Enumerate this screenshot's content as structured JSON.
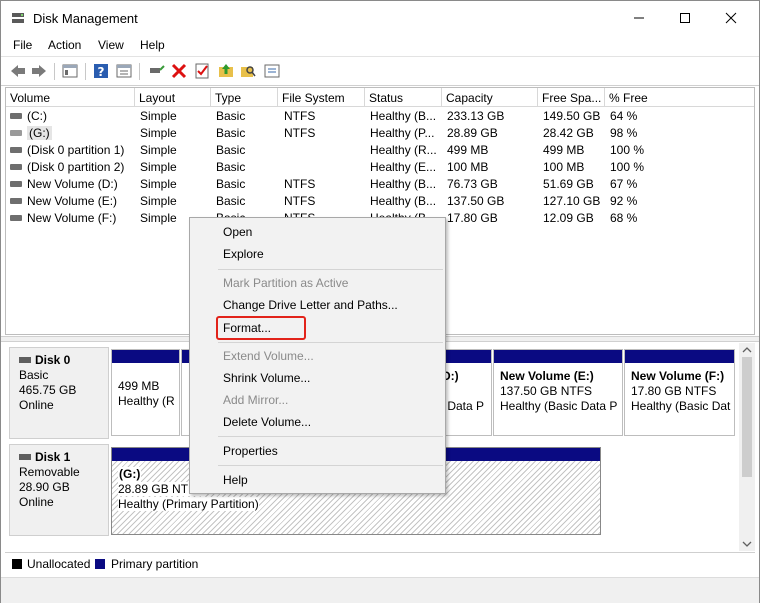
{
  "window": {
    "title": "Disk Management"
  },
  "menu": [
    "File",
    "Action",
    "View",
    "Help"
  ],
  "columns": [
    "Volume",
    "Layout",
    "Type",
    "File System",
    "Status",
    "Capacity",
    "Free Spa...",
    "% Free"
  ],
  "volumes": [
    {
      "volume": "(C:)",
      "layout": "Simple",
      "type": "Basic",
      "fs": "NTFS",
      "status": "Healthy (B...",
      "capacity": "233.13 GB",
      "free": "149.50 GB",
      "pct": "64 %"
    },
    {
      "volume": "(G:)",
      "layout": "Simple",
      "type": "Basic",
      "fs": "NTFS",
      "status": "Healthy (P...",
      "capacity": "28.89 GB",
      "free": "28.42 GB",
      "pct": "98 %"
    },
    {
      "volume": "(Disk 0 partition 1)",
      "layout": "Simple",
      "type": "Basic",
      "fs": "",
      "status": "Healthy (R...",
      "capacity": "499 MB",
      "free": "499 MB",
      "pct": "100 %"
    },
    {
      "volume": "(Disk 0 partition 2)",
      "layout": "Simple",
      "type": "Basic",
      "fs": "",
      "status": "Healthy (E...",
      "capacity": "100 MB",
      "free": "100 MB",
      "pct": "100 %"
    },
    {
      "volume": "New Volume (D:)",
      "layout": "Simple",
      "type": "Basic",
      "fs": "NTFS",
      "status": "Healthy (B...",
      "capacity": "76.73 GB",
      "free": "51.69 GB",
      "pct": "67 %"
    },
    {
      "volume": "New Volume (E:)",
      "layout": "Simple",
      "type": "Basic",
      "fs": "NTFS",
      "status": "Healthy (B...",
      "capacity": "137.50 GB",
      "free": "127.10 GB",
      "pct": "92 %"
    },
    {
      "volume": "New Volume (F:)",
      "layout": "Simple",
      "type": "Basic",
      "fs": "NTFS",
      "status": "Healthy (B...",
      "capacity": "17.80 GB",
      "free": "12.09 GB",
      "pct": "68 %"
    }
  ],
  "disk0": {
    "name": "Disk 0",
    "type": "Basic",
    "size": "465.75 GB",
    "state": "Online",
    "p1": {
      "line1": "499 MB",
      "line2": "Healthy (R"
    },
    "pD": {
      "label": "(D:)",
      "line2": "c Data P"
    },
    "pE": {
      "label": "New Volume  (E:)",
      "line1": "137.50 GB NTFS",
      "line2": "Healthy (Basic Data P"
    },
    "pF": {
      "label": "New Volume  (F:)",
      "line1": "17.80 GB NTFS",
      "line2": "Healthy (Basic Dat"
    }
  },
  "disk1": {
    "name": "Disk 1",
    "type": "Removable",
    "size": "28.90 GB",
    "state": "Online",
    "pG": {
      "label": "(G:)",
      "line1": "28.89 GB NTFS",
      "line2": "Healthy (Primary Partition)"
    }
  },
  "legend": {
    "unallocated": "Unallocated",
    "primary": "Primary partition"
  },
  "colors": {
    "primary": "#0a0a82",
    "unallocated": "#000000",
    "highlight": "#e2231a"
  },
  "context_menu": {
    "open": "Open",
    "explore": "Explore",
    "mark_active": "Mark Partition as Active",
    "change_letter": "Change Drive Letter and Paths...",
    "format": "Format...",
    "extend": "Extend Volume...",
    "shrink": "Shrink Volume...",
    "add_mirror": "Add Mirror...",
    "delete": "Delete Volume...",
    "properties": "Properties",
    "help": "Help"
  }
}
